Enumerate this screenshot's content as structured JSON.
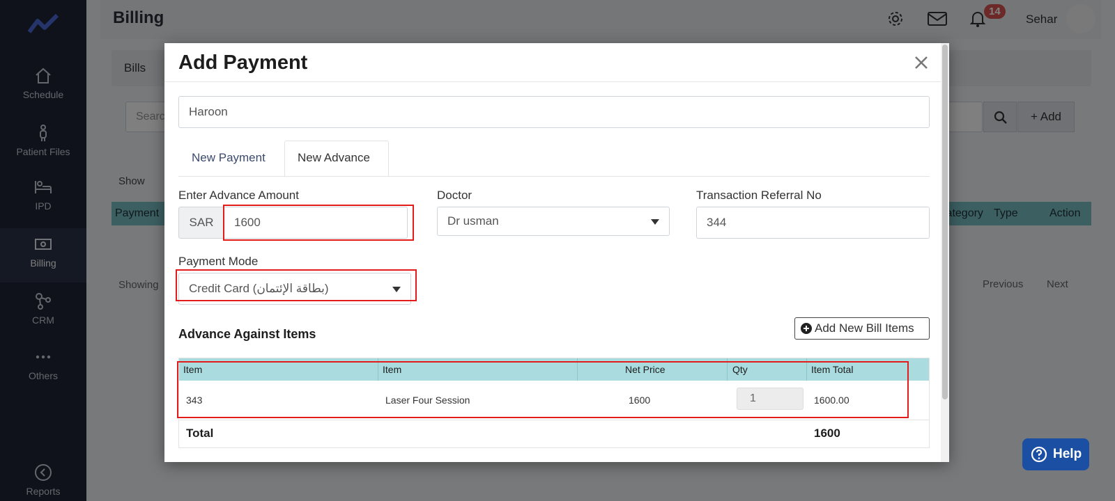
{
  "page": {
    "title": "Billing",
    "notification_count": "14",
    "user_name": "Sehar"
  },
  "sidebar": {
    "items": [
      {
        "label": "Schedule"
      },
      {
        "label": "Patient Files"
      },
      {
        "label": "IPD"
      },
      {
        "label": "Billing"
      },
      {
        "label": "CRM"
      },
      {
        "label": "Others"
      },
      {
        "label": "Reports"
      }
    ]
  },
  "background": {
    "tab": "Bills",
    "search_placeholder": "Searc",
    "add_label": "Add",
    "show_label": "Show",
    "columns": {
      "payment": "Payment",
      "category": "Category",
      "type": "Type",
      "action": "Action"
    },
    "showing": "Showing",
    "previous": "Previous",
    "next": "Next"
  },
  "modal": {
    "title": "Add Payment",
    "patient": "Haroon",
    "tabs": [
      "New Payment",
      "New Advance"
    ],
    "amount_label": "Enter Advance Amount",
    "currency": "SAR",
    "amount": "1600",
    "doctor_label": "Doctor",
    "doctor": "Dr usman",
    "txn_label": "Transaction Referral No",
    "txn": "344",
    "mode_label": "Payment Mode",
    "mode": "Credit Card (بطاقة الإئتمان)",
    "section_title": "Advance Against Items",
    "add_items_label": "Add New Bill Items",
    "table": {
      "headers": [
        "Item",
        "Item",
        "",
        "Net Price",
        "Qty",
        "Item Total"
      ],
      "rows": [
        {
          "item_code": "343",
          "item_name": "Laser Four Session",
          "net_price": "1600",
          "qty": "1",
          "total": "1600.00"
        }
      ],
      "total_label": "Total",
      "total_value": "1600"
    }
  },
  "help": {
    "label": "Help"
  },
  "colors": {
    "sidebar": "#1f2535",
    "table_header": "#a9dbdf",
    "highlight": "#e31b1b",
    "help_button": "#1b4fa3"
  }
}
